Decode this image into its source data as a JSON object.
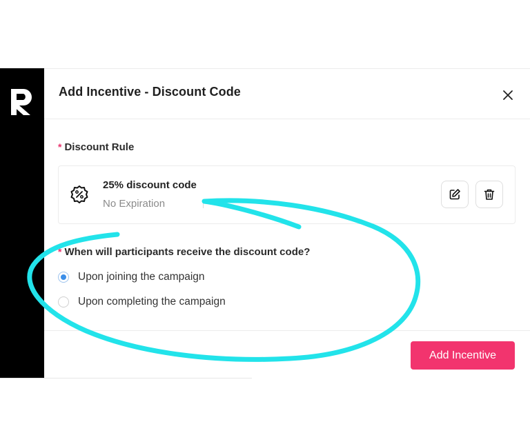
{
  "modal": {
    "title": "Add Incentive - Discount Code"
  },
  "discount_rule": {
    "required_mark": "*",
    "label": "Discount Rule",
    "name": "25% discount code",
    "expiration": "No Expiration"
  },
  "delivery": {
    "required_mark": "*",
    "question": "When will participants receive the discount code?",
    "options": [
      {
        "label": "Upon joining the campaign",
        "selected": true
      },
      {
        "label": "Upon completing the campaign",
        "selected": false
      }
    ]
  },
  "footer": {
    "submit_label": "Add Incentive"
  },
  "colors": {
    "accent": "#f2346e",
    "radio_selected": "#3b8ee8",
    "annotation": "#22e3ea",
    "sidebar": "#000000"
  },
  "icons": {
    "logo": "r-logo",
    "close": "close-icon",
    "discount": "percent-badge-icon",
    "edit": "edit-icon",
    "delete": "trash-icon"
  }
}
